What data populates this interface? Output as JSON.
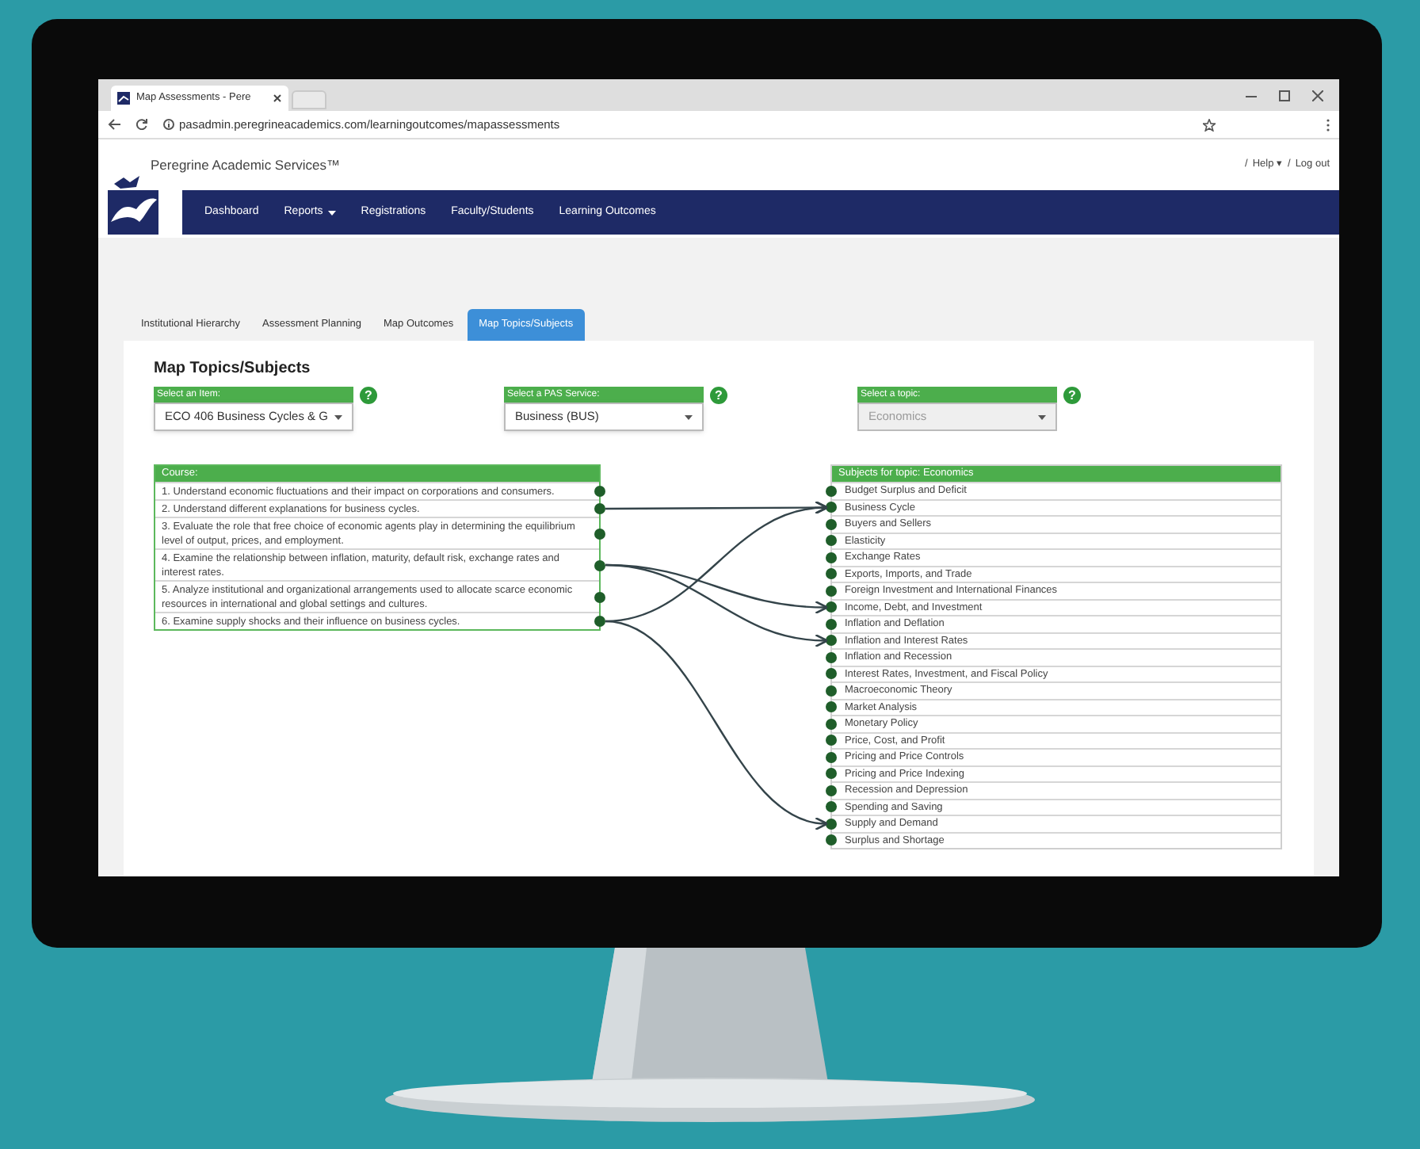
{
  "browser": {
    "tab_title": "Map Assessments - Pere",
    "url": "pasadmin.peregrineacademics.com/learningoutcomes/mapassessments"
  },
  "header": {
    "title": "Peregrine Academic Services™",
    "separator_1": "/",
    "help": "Help ▾",
    "separator_2": "/",
    "logout": "Log out"
  },
  "nav": [
    {
      "label": "Dashboard",
      "dropdown": false
    },
    {
      "label": "Reports",
      "dropdown": true
    },
    {
      "label": "Registrations",
      "dropdown": false
    },
    {
      "label": "Faculty/Students",
      "dropdown": false
    },
    {
      "label": "Learning Outcomes",
      "dropdown": false
    }
  ],
  "tabs": [
    {
      "label": "Institutional Hierarchy",
      "selected": false
    },
    {
      "label": "Assessment Planning",
      "selected": false
    },
    {
      "label": "Map Outcomes",
      "selected": false
    },
    {
      "label": "Map Topics/Subjects",
      "selected": true
    }
  ],
  "page_title": "Map Topics/Subjects",
  "selectors": [
    {
      "label": "Select an Item:",
      "value": "ECO 406 Business Cycles & G",
      "disabled": false,
      "help": "?"
    },
    {
      "label": "Select a PAS Service:",
      "value": "Business (BUS)",
      "disabled": false,
      "help": "?"
    },
    {
      "label": "Select a topic:",
      "value": "Economics",
      "disabled": true,
      "help": "?"
    }
  ],
  "course": {
    "header": "Course:",
    "outcomes": [
      "1. Understand economic fluctuations and their impact on corporations and consumers.",
      "2. Understand different explanations for business cycles.",
      "3. Evaluate the role that free choice of economic agents play in determining the equilibrium level of output, prices, and employment.",
      "4. Examine the relationship between inflation, maturity, default risk, exchange rates and interest rates.",
      "5. Analyze institutional and organizational arrangements used to allocate scarce economic resources in international and global settings and cultures.",
      "6. Examine supply shocks and their influence on business cycles."
    ]
  },
  "subjects": {
    "header": "Subjects for topic: Economics",
    "rows": [
      {
        "text": "Budget Surplus and Deficit",
        "arrows_from": [
          false,
          false,
          false,
          false,
          false,
          false
        ]
      },
      {
        "text": "Business Cycle",
        "arrows_from": [
          false,
          true,
          false,
          false,
          false,
          true
        ]
      },
      {
        "text": "Buyers and Sellers",
        "arrows_from": [
          false,
          false,
          false,
          false,
          false,
          false
        ]
      },
      {
        "text": "Elasticity",
        "arrows_from": [
          false,
          false,
          false,
          false,
          false,
          false
        ]
      },
      {
        "text": "Exchange Rates",
        "arrows_from": [
          false,
          false,
          false,
          false,
          false,
          false
        ]
      },
      {
        "text": "Exports, Imports, and Trade",
        "arrows_from": [
          false,
          false,
          false,
          false,
          false,
          false
        ]
      },
      {
        "text": "Foreign Investment and International Finances",
        "arrows_from": [
          false,
          false,
          false,
          false,
          false,
          false
        ]
      },
      {
        "text": "Income, Debt, and Investment",
        "arrows_from": [
          false,
          false,
          false,
          true,
          false,
          false
        ]
      },
      {
        "text": "Inflation and Deflation",
        "arrows_from": [
          false,
          false,
          false,
          false,
          false,
          false
        ]
      },
      {
        "text": "Inflation and Interest Rates",
        "arrows_from": [
          false,
          false,
          false,
          true,
          false,
          false
        ]
      },
      {
        "text": "Inflation and Recession",
        "arrows_from": [
          false,
          false,
          false,
          false,
          false,
          false
        ]
      },
      {
        "text": "Interest Rates, Investment, and Fiscal Policy",
        "arrows_from": [
          false,
          false,
          false,
          false,
          false,
          false
        ]
      },
      {
        "text": "Macroeconomic Theory",
        "arrows_from": [
          false,
          false,
          false,
          false,
          false,
          false
        ]
      },
      {
        "text": "Market Analysis",
        "arrows_from": [
          false,
          false,
          false,
          false,
          false,
          false
        ]
      },
      {
        "text": "Monetary Policy",
        "arrows_from": [
          false,
          false,
          false,
          false,
          false,
          false
        ]
      },
      {
        "text": "Price, Cost, and Profit",
        "arrows_from": [
          false,
          false,
          false,
          false,
          false,
          false
        ]
      },
      {
        "text": "Pricing and Price Controls",
        "arrows_from": [
          false,
          false,
          false,
          false,
          false,
          false
        ]
      },
      {
        "text": "Pricing and Price Indexing",
        "arrows_from": [
          false,
          false,
          false,
          false,
          false,
          false
        ]
      },
      {
        "text": "Recession and Depression",
        "arrows_from": [
          false,
          false,
          false,
          false,
          false,
          false
        ]
      },
      {
        "text": "Spending and Saving",
        "arrows_from": [
          false,
          false,
          false,
          false,
          false,
          false
        ]
      },
      {
        "text": "Supply and Demand",
        "arrows_from": [
          false,
          false,
          false,
          false,
          false,
          true
        ]
      },
      {
        "text": "Surplus and Shortage",
        "arrows_from": [
          false,
          false,
          false,
          false,
          false,
          false
        ]
      }
    ]
  }
}
